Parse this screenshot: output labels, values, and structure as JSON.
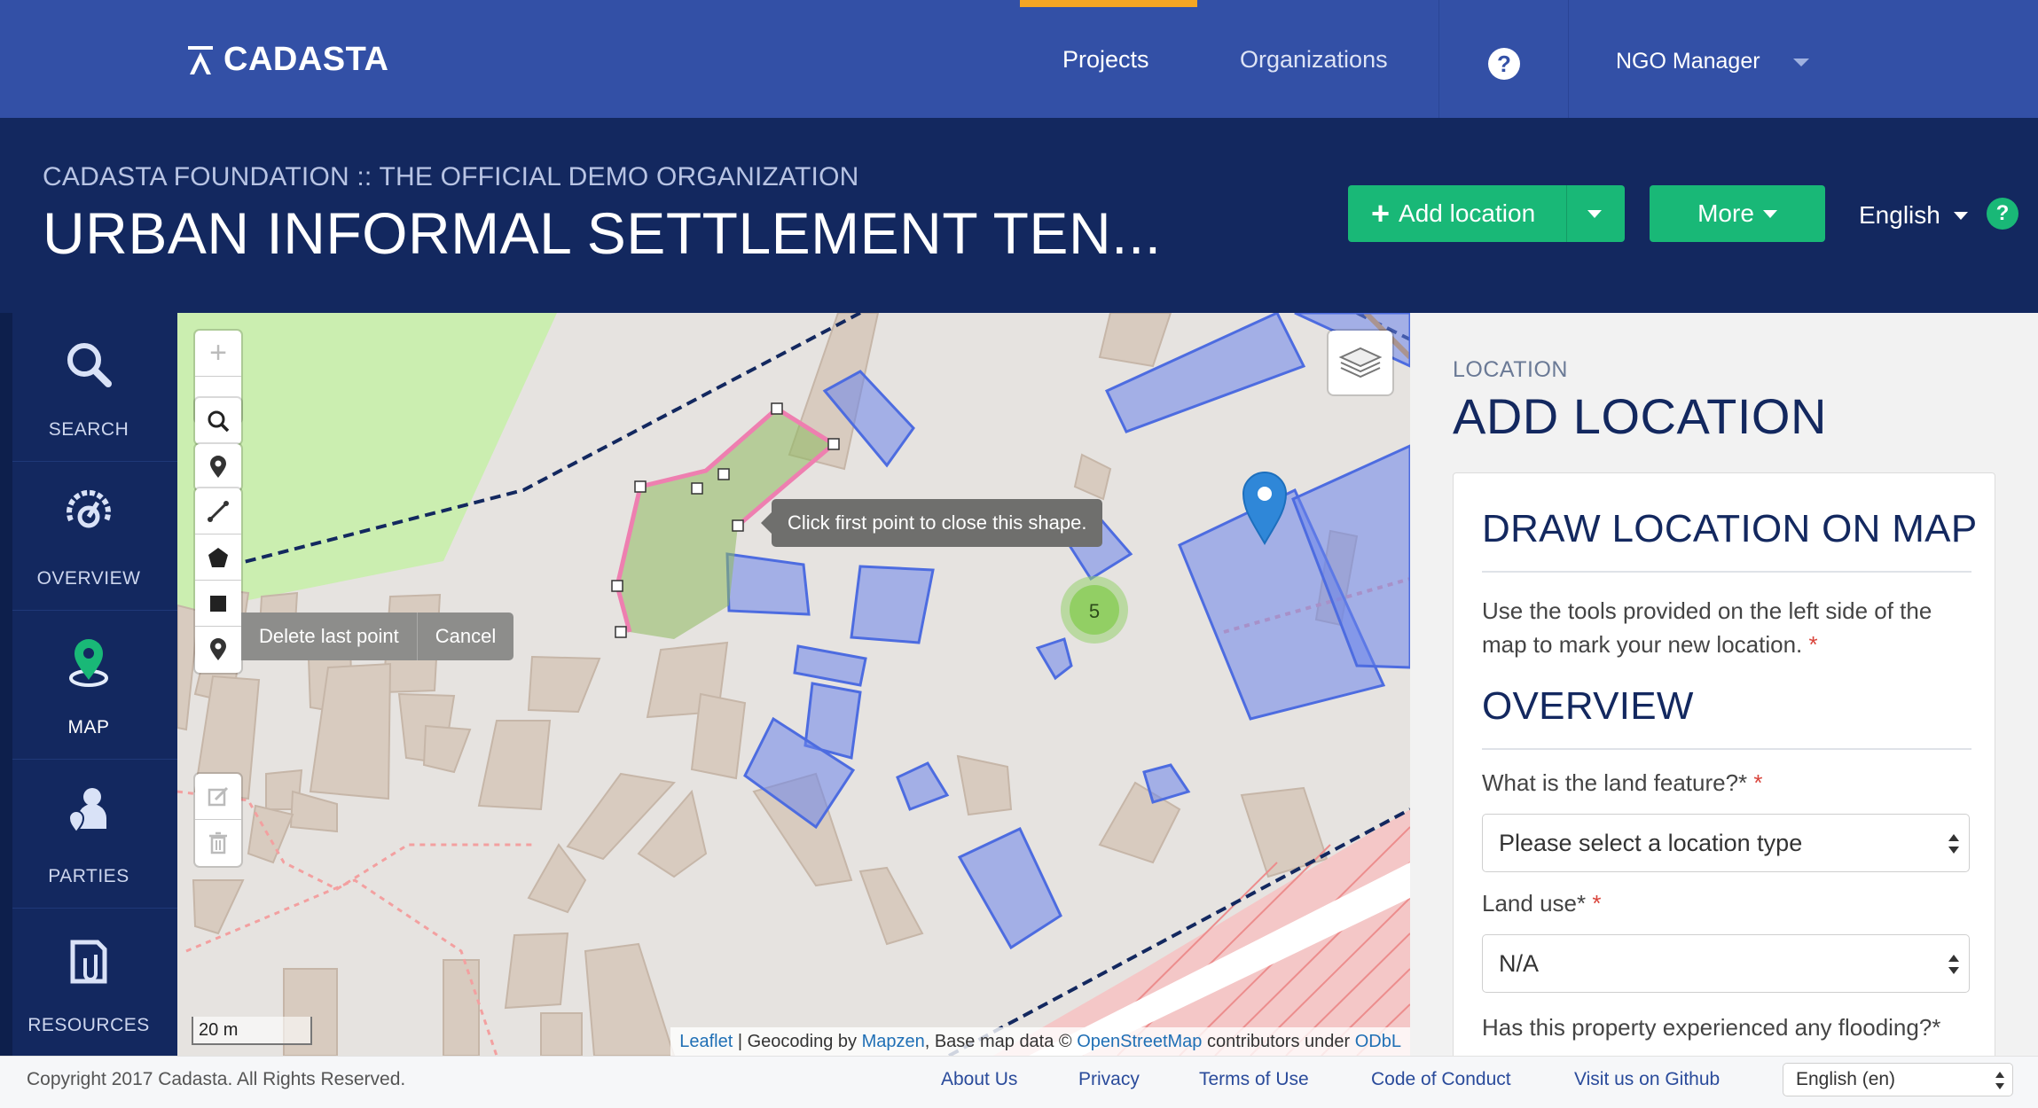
{
  "brand": {
    "name": "CADASTA"
  },
  "nav": {
    "projects": "Projects",
    "organizations": "Organizations",
    "help": "?",
    "user": "NGO Manager"
  },
  "project": {
    "organization": "CADASTA FOUNDATION :: THE OFFICIAL DEMO ORGANIZATION",
    "title": "URBAN INFORMAL SETTLEMENT TEN...",
    "add_location": "Add location",
    "more": "More",
    "language": "English",
    "help": "?"
  },
  "sidebar": {
    "items": [
      {
        "label": "SEARCH",
        "icon": "search-icon"
      },
      {
        "label": "OVERVIEW",
        "icon": "overview-gauge-icon"
      },
      {
        "label": "MAP",
        "icon": "map-pin-icon",
        "active": true
      },
      {
        "label": "PARTIES",
        "icon": "parties-icon"
      },
      {
        "label": "RESOURCES",
        "icon": "resources-icon"
      }
    ]
  },
  "map": {
    "zoom_in": "+",
    "zoom_out": "−",
    "draw_actions": {
      "delete_last": "Delete last point",
      "cancel": "Cancel"
    },
    "tooltip": "Click first point to close this shape.",
    "cluster_count": "5",
    "scale": "20 m",
    "attribution": {
      "leaflet": "Leaflet",
      "sep1": " | Geocoding by ",
      "mapzen": "Mapzen",
      "sep2": ", Base map data © ",
      "osm": "OpenStreetMap",
      "sep3": " contributors under ",
      "odbl": "ODbL"
    }
  },
  "panel": {
    "kicker": "LOCATION",
    "title": "ADD LOCATION",
    "draw_heading": "DRAW LOCATION ON MAP",
    "draw_text": "Use the tools provided on the left side of the map to mark your new location.",
    "required_mark": "*",
    "overview_heading": "OVERVIEW",
    "land_feature_label": "What is the land feature?*",
    "land_feature_value": "Please select a location type",
    "land_use_label": "Land use*",
    "land_use_value": "N/A",
    "flooding_label": "Has this property experienced any flooding?*"
  },
  "footer": {
    "copyright": "Copyright 2017 Cadasta. All Rights Reserved.",
    "links": [
      "About Us",
      "Privacy",
      "Terms of Use",
      "Code of Conduct",
      "Visit us on Github"
    ],
    "language": "English (en)"
  },
  "colors": {
    "nav": "#3350a6",
    "header": "#13285f",
    "accent_green": "#19b877",
    "active_orange": "#f5a623",
    "parcel_blue": "#7f96f0",
    "draw_pink": "#ee7fb0"
  }
}
